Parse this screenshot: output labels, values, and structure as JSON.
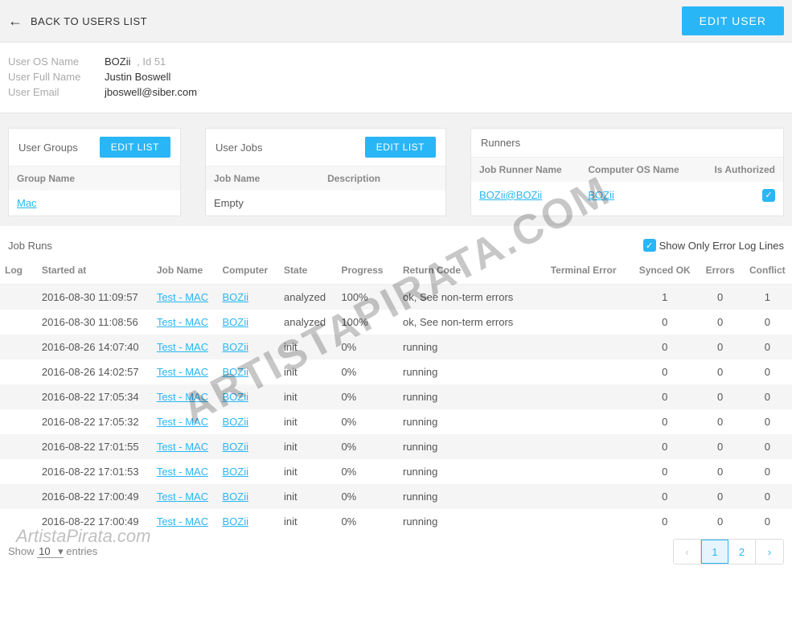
{
  "header": {
    "back_label": "BACK TO USERS LIST",
    "edit_user_label": "EDIT USER"
  },
  "user": {
    "os_name_label": "User OS Name",
    "os_name_value": "BOZii",
    "id_label": ", Id",
    "id_value": "51",
    "full_name_label": "User Full Name",
    "full_name_value": "Justin Boswell",
    "email_label": "User Email",
    "email_value": "jboswell@siber.com"
  },
  "panels": {
    "groups": {
      "title": "User Groups",
      "edit_label": "EDIT LIST",
      "col_group": "Group Name",
      "rows": [
        {
          "name": "Mac"
        }
      ]
    },
    "jobs": {
      "title": "User Jobs",
      "edit_label": "EDIT LIST",
      "col_job": "Job Name",
      "col_desc": "Description",
      "rows": [
        {
          "name": "Empty",
          "desc": ""
        }
      ]
    },
    "runners": {
      "title": "Runners",
      "col_runner": "Job Runner Name",
      "col_os": "Computer OS Name",
      "col_auth": "Is Authorized",
      "rows": [
        {
          "runner": "BOZii@BOZii",
          "os": "BOZii",
          "authorized": true
        }
      ]
    }
  },
  "jobruns": {
    "title": "Job Runs",
    "show_errors_label": "Show Only Error Log Lines",
    "show_errors_checked": true,
    "columns": {
      "log": "Log",
      "started": "Started at",
      "job": "Job Name",
      "computer": "Computer",
      "state": "State",
      "progress": "Progress",
      "return_code": "Return Code",
      "terminal_error": "Terminal Error",
      "synced": "Synced OK",
      "errors": "Errors",
      "conflict": "Conflict"
    },
    "rows": [
      {
        "started": "2016-08-30 11:09:57",
        "job": "Test - MAC",
        "computer": "BOZii",
        "state": "analyzed",
        "progress": "100%",
        "rc": "ok, See non-term errors",
        "te": "",
        "synced": "1",
        "errors": "0",
        "conflict": "1"
      },
      {
        "started": "2016-08-30 11:08:56",
        "job": "Test - MAC",
        "computer": "BOZii",
        "state": "analyzed",
        "progress": "100%",
        "rc": "ok, See non-term errors",
        "te": "",
        "synced": "0",
        "errors": "0",
        "conflict": "0"
      },
      {
        "started": "2016-08-26 14:07:40",
        "job": "Test - MAC",
        "computer": "BOZii",
        "state": "init",
        "progress": "0%",
        "rc": "running",
        "te": "",
        "synced": "0",
        "errors": "0",
        "conflict": "0"
      },
      {
        "started": "2016-08-26 14:02:57",
        "job": "Test - MAC",
        "computer": "BOZii",
        "state": "init",
        "progress": "0%",
        "rc": "running",
        "te": "",
        "synced": "0",
        "errors": "0",
        "conflict": "0"
      },
      {
        "started": "2016-08-22 17:05:34",
        "job": "Test - MAC",
        "computer": "BOZii",
        "state": "init",
        "progress": "0%",
        "rc": "running",
        "te": "",
        "synced": "0",
        "errors": "0",
        "conflict": "0"
      },
      {
        "started": "2016-08-22 17:05:32",
        "job": "Test - MAC",
        "computer": "BOZii",
        "state": "init",
        "progress": "0%",
        "rc": "running",
        "te": "",
        "synced": "0",
        "errors": "0",
        "conflict": "0"
      },
      {
        "started": "2016-08-22 17:01:55",
        "job": "Test - MAC",
        "computer": "BOZii",
        "state": "init",
        "progress": "0%",
        "rc": "running",
        "te": "",
        "synced": "0",
        "errors": "0",
        "conflict": "0"
      },
      {
        "started": "2016-08-22 17:01:53",
        "job": "Test - MAC",
        "computer": "BOZii",
        "state": "init",
        "progress": "0%",
        "rc": "running",
        "te": "",
        "synced": "0",
        "errors": "0",
        "conflict": "0"
      },
      {
        "started": "2016-08-22 17:00:49",
        "job": "Test - MAC",
        "computer": "BOZii",
        "state": "init",
        "progress": "0%",
        "rc": "running",
        "te": "",
        "synced": "0",
        "errors": "0",
        "conflict": "0"
      },
      {
        "started": "2016-08-22 17:00:49",
        "job": "Test - MAC",
        "computer": "BOZii",
        "state": "init",
        "progress": "0%",
        "rc": "running",
        "te": "",
        "synced": "0",
        "errors": "0",
        "conflict": "0"
      }
    ]
  },
  "footer": {
    "show_label_pre": "Show",
    "show_value": "10",
    "show_label_post": "entries",
    "page_prev": "‹",
    "page_1": "1",
    "page_2": "2",
    "page_next": "›"
  },
  "watermark": "ARTISTAPIRATA.COM",
  "watermark2": "ArtistaPirata.com"
}
